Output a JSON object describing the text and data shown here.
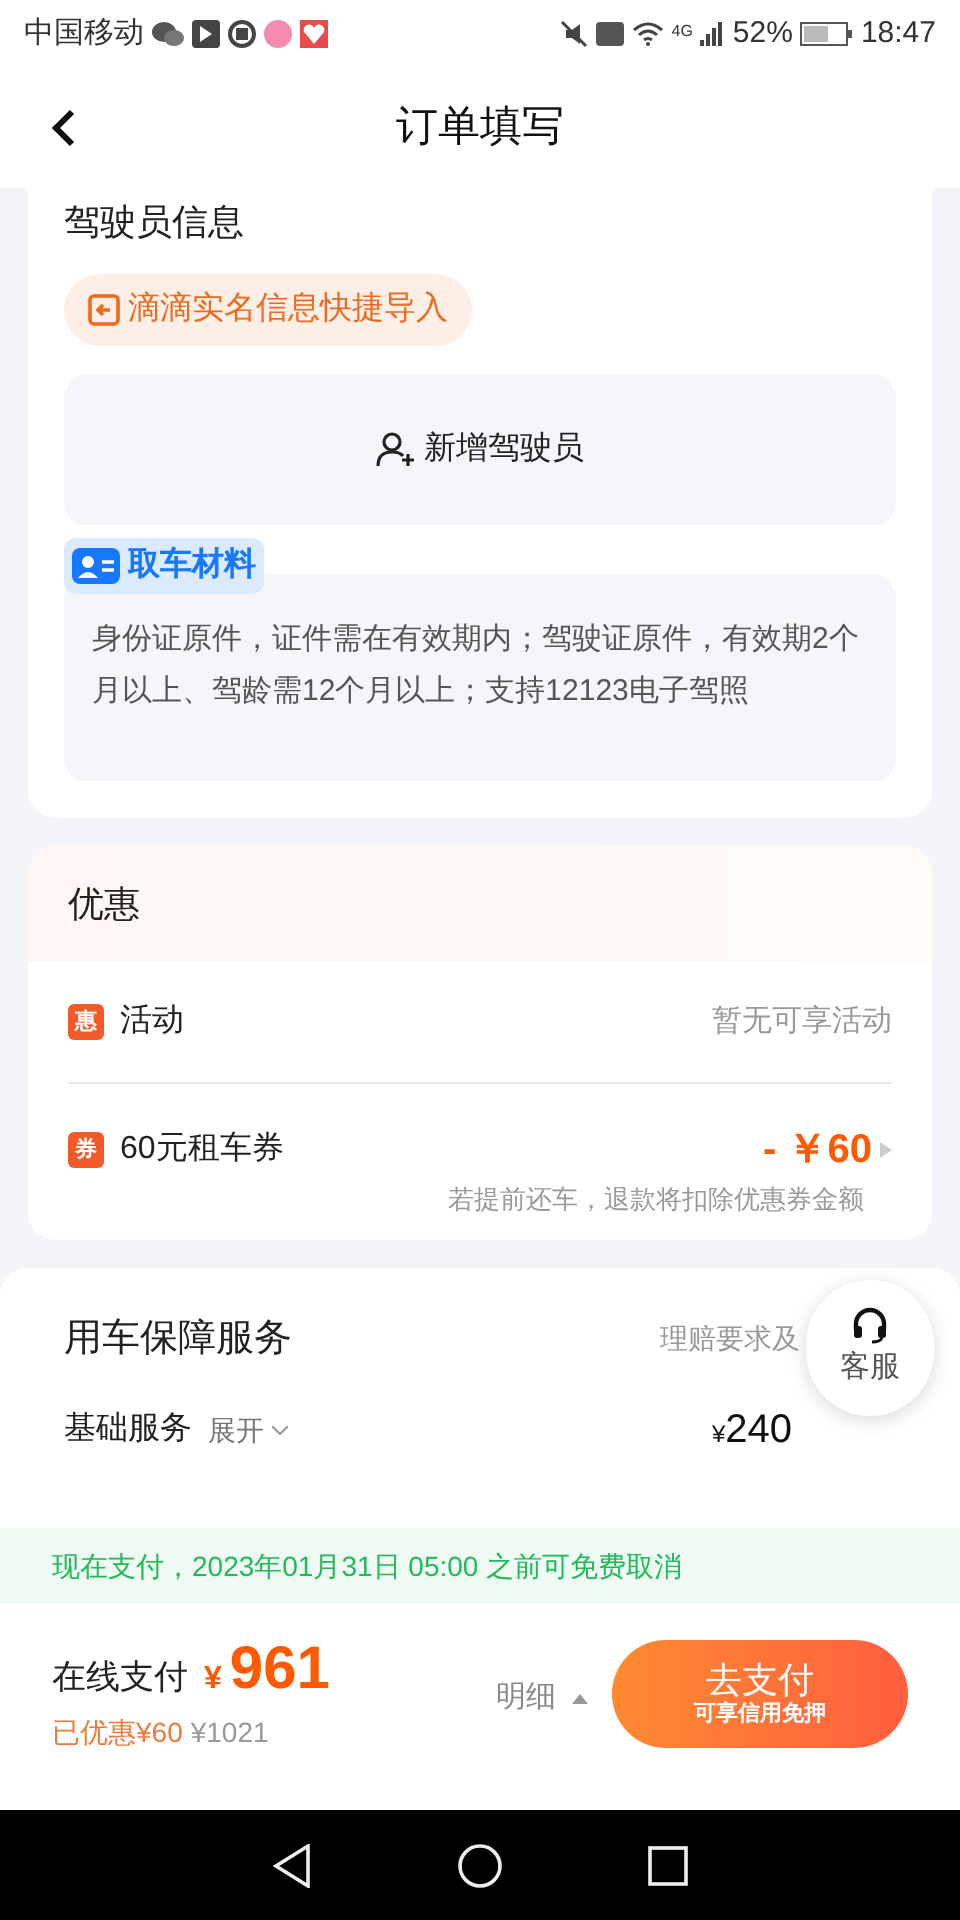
{
  "status_bar": {
    "carrier": "中国移动",
    "network": "4G",
    "battery": "52%",
    "time": "18:47"
  },
  "header": {
    "title": "订单填写"
  },
  "driver": {
    "title": "驾驶员信息",
    "import_button": "滴滴实名信息快捷导入",
    "add_button": "新增驾驶员",
    "materials_tag": "取车材料",
    "materials_text": "身份证原件，证件需在有效期内；驾驶证原件，有效期2个月以上、驾龄需12个月以上；支持12123电子驾照"
  },
  "discounts": {
    "title": "优惠",
    "items": [
      {
        "badge": "惠",
        "label": "活动",
        "value": "暂无可享活动",
        "kind": "plain"
      },
      {
        "badge": "券",
        "label": "60元租车券",
        "value": "- ￥60",
        "note": "若提前还车，退款将扣除优惠券金额",
        "kind": "coupon"
      }
    ]
  },
  "protection": {
    "title": "用车保障服务",
    "link": "理赔要求及",
    "basic_label": "基础服务",
    "expand": "展开",
    "price_symbol": "¥",
    "price": "240"
  },
  "service_button": "客服",
  "notice": "现在支付，2023年01月31日 05:00 之前可免费取消",
  "payment": {
    "label": "在线支付",
    "currency": "¥",
    "amount": "961",
    "saved": "已优惠¥60",
    "original": "¥1021",
    "details": "明细",
    "pay_button": "去支付",
    "pay_subtitle": "可享信用免押"
  }
}
